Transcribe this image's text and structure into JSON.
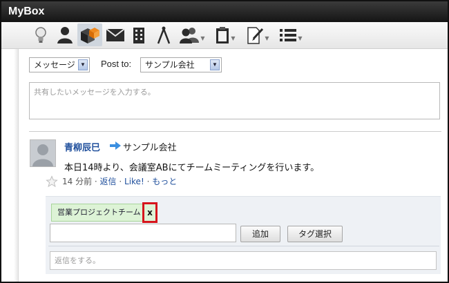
{
  "window": {
    "title": "MyBox"
  },
  "toolbar": {
    "icons": [
      "lightbulb-icon",
      "person-icon",
      "boxes-icon",
      "mail-icon",
      "building-icon",
      "compass-icon",
      "group-icon",
      "clipboard-icon",
      "pen-document-icon",
      "list-icon"
    ]
  },
  "composer": {
    "type_value": "メッセージ",
    "post_to_label": "Post to:",
    "post_to_value": "サンプル会社",
    "message_placeholder": "共有したいメッセージを入力する。"
  },
  "post": {
    "author": "青柳辰巳",
    "target": "サンプル会社",
    "body": "本日14時より、会議室ABにてチームミーティングを行います。",
    "time": "14 分前",
    "sep1": " · ",
    "reply": "返信",
    "sep2": " · ",
    "like": "Like!",
    "sep3": " · ",
    "more": "もっと"
  },
  "tags": {
    "chip_label": "営業プロジェクトチーム",
    "remove_label": "x",
    "input_value": "",
    "add_button": "追加",
    "select_button": "タグ選択"
  },
  "reply": {
    "placeholder": "返信をする。"
  },
  "colors": {
    "link": "#1f4f9c",
    "highlight": "#d6141c",
    "tag_bg": "#ddf3d6"
  }
}
